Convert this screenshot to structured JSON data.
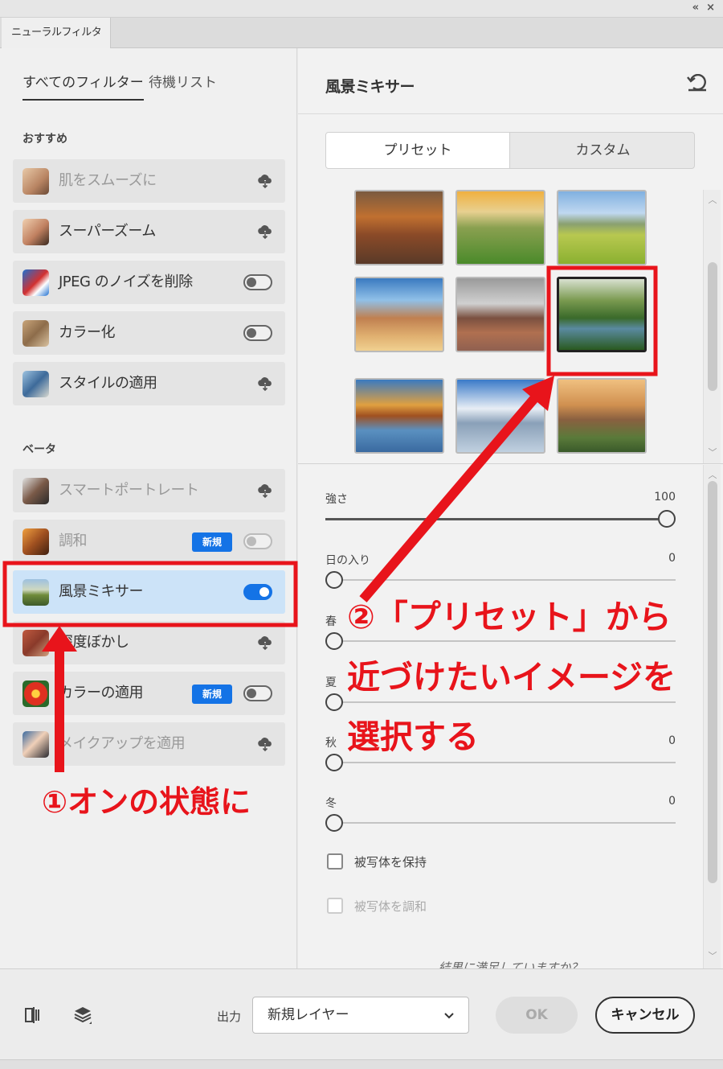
{
  "window": {
    "collapse_glyph": "«",
    "close_glyph": "×"
  },
  "panel_tab": {
    "label": "ニューラルフィルター"
  },
  "left_tabs": {
    "all": "すべてのフィルター",
    "waitlist": "待機リスト"
  },
  "sections": {
    "featured": "おすすめ",
    "beta": "ベータ"
  },
  "featured_items": [
    {
      "label": "肌をスムーズに",
      "control": "cloud",
      "dim": true,
      "thumb": "portrait-woman"
    },
    {
      "label": "スーパーズーム",
      "control": "cloud",
      "dim": false,
      "thumb": "portrait-man-glasses"
    },
    {
      "label": "JPEG のノイズを削除",
      "control": "toggle-off",
      "dim": false,
      "thumb": "parrot"
    },
    {
      "label": "カラー化",
      "control": "toggle-off",
      "dim": false,
      "thumb": "group-photo"
    },
    {
      "label": "スタイルの適用",
      "control": "cloud",
      "dim": false,
      "thumb": "painting"
    }
  ],
  "beta_items": [
    {
      "label": "スマートポートレート",
      "control": "cloud",
      "dim": true,
      "thumb": "portrait-man"
    },
    {
      "label": "調和",
      "control": "toggle-off-dim",
      "dim": true,
      "badge": "新規",
      "thumb": "portrait-woman-2"
    },
    {
      "label": "風景ミキサー",
      "control": "toggle-on",
      "dim": false,
      "selected": true,
      "thumb": "landscape"
    },
    {
      "label": "深度ぼかし",
      "control": "cloud",
      "dim": false,
      "thumb": "canyon-red"
    },
    {
      "label": "カラーの適用",
      "control": "toggle-off",
      "dim": false,
      "badge": "新規",
      "thumb": "flower"
    },
    {
      "label": "メイクアップを適用",
      "control": "cloud",
      "dim": true,
      "thumb": "portrait-eye"
    }
  ],
  "right_panel": {
    "title": "風景ミキサー",
    "tabs": {
      "preset": "プリセット",
      "custom": "カスタム"
    },
    "presets": [
      "canyon",
      "sunset-hills",
      "alpine-meadow",
      "desert-rocks",
      "monument-valley",
      "green-river",
      "autumn-lake",
      "snow-peaks",
      "yosemite"
    ],
    "selected_preset_index": 5
  },
  "sliders": [
    {
      "label": "強さ",
      "value": "100",
      "level": 1.0
    },
    {
      "label": "日の入り",
      "value": "0",
      "level": 0
    },
    {
      "label": "春",
      "value": "0",
      "level": 0
    },
    {
      "label": "夏",
      "value": "0",
      "level": 0
    },
    {
      "label": "秋",
      "value": "0",
      "level": 0
    },
    {
      "label": "冬",
      "value": "0",
      "level": 0
    }
  ],
  "checkboxes": [
    {
      "label": "被写体を保持",
      "checked": false,
      "enabled": true
    },
    {
      "label": "被写体を調和",
      "checked": false,
      "enabled": false
    }
  ],
  "feedback_text": "結果に満足していますか？",
  "bottom": {
    "output_label": "出力",
    "output_value": "新規レイヤー",
    "ok": "OK",
    "cancel": "キャンセル"
  },
  "annotations": {
    "step1": "①オンの状態に",
    "step2_line1": "②「プリセット」から",
    "step2_line2": "近づけたいイメージを",
    "step2_line3": "選択する",
    "color": "#e8141b"
  },
  "colors": {
    "accent": "#1473e6",
    "selected_row": "#cce3f8",
    "annotation": "#e8141b"
  }
}
